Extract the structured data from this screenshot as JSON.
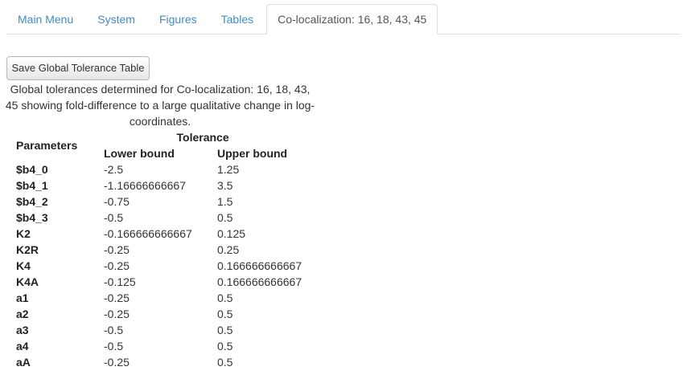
{
  "tabs": [
    {
      "label": "Main Menu",
      "active": false
    },
    {
      "label": "System",
      "active": false
    },
    {
      "label": "Figures",
      "active": false
    },
    {
      "label": "Tables",
      "active": false
    },
    {
      "label": "Co-localization: 16, 18, 43, 45",
      "active": true
    }
  ],
  "save_button_label": "Save Global Tolerance Table",
  "caption": "Global tolerances determined for Co-localization: 16, 18, 43, 45 showing fold-difference to a large qualitative change in log-coordinates.",
  "table": {
    "headers": {
      "parameters": "Parameters",
      "tolerance": "Tolerance",
      "lower": "Lower bound",
      "upper": "Upper bound"
    },
    "rows": [
      {
        "param": "$b4_0",
        "lower": "-2.5",
        "upper": "1.25"
      },
      {
        "param": "$b4_1",
        "lower": "-1.16666666667",
        "upper": "3.5"
      },
      {
        "param": "$b4_2",
        "lower": "-0.75",
        "upper": "1.5"
      },
      {
        "param": "$b4_3",
        "lower": "-0.5",
        "upper": "0.5"
      },
      {
        "param": "K2",
        "lower": "-0.166666666667",
        "upper": "0.125"
      },
      {
        "param": "K2R",
        "lower": "-0.25",
        "upper": "0.25"
      },
      {
        "param": "K4",
        "lower": "-0.25",
        "upper": "0.166666666667"
      },
      {
        "param": "K4A",
        "lower": "-0.125",
        "upper": "0.166666666667"
      },
      {
        "param": "a1",
        "lower": "-0.25",
        "upper": "0.5"
      },
      {
        "param": "a2",
        "lower": "-0.25",
        "upper": "0.5"
      },
      {
        "param": "a3",
        "lower": "-0.5",
        "upper": "0.5"
      },
      {
        "param": "a4",
        "lower": "-0.5",
        "upper": "0.5"
      },
      {
        "param": "aA",
        "lower": "-0.25",
        "upper": "0.5"
      }
    ]
  },
  "colors": {
    "link": "#428bca",
    "active_tab_text": "#555555",
    "border": "#dddddd"
  }
}
